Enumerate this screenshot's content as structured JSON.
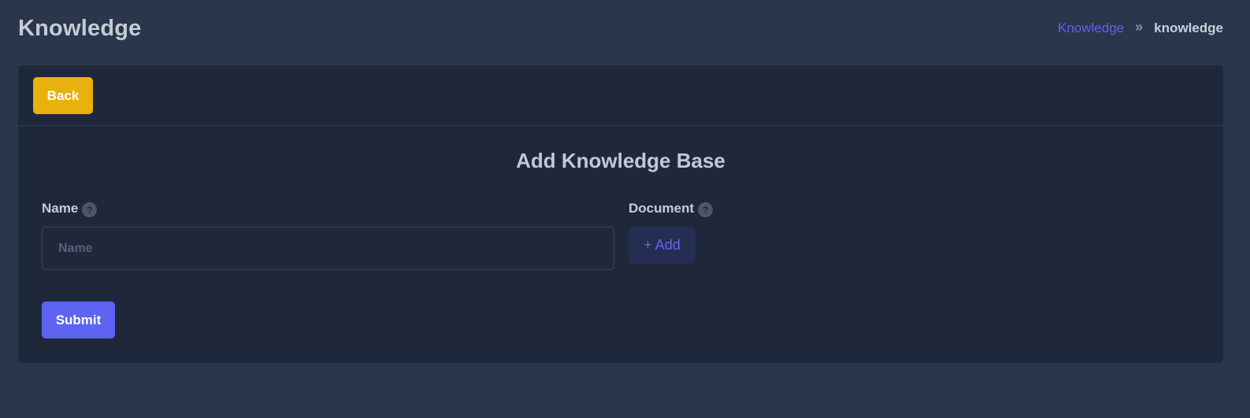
{
  "header": {
    "title": "Knowledge",
    "breadcrumb": {
      "link_label": "Knowledge",
      "separator": "»",
      "current_label": "knowledge"
    }
  },
  "card": {
    "back_label": "Back",
    "form_title": "Add Knowledge Base",
    "name_field": {
      "label": "Name",
      "help_icon": "question-circle-icon",
      "help_glyph": "?",
      "placeholder": "Name",
      "value": ""
    },
    "document_field": {
      "label": "Document",
      "help_icon": "question-circle-icon",
      "help_glyph": "?",
      "add_label": "+ Add"
    },
    "submit_label": "Submit"
  },
  "colors": {
    "page_background": "#2a364c",
    "card_background": "#1f283b",
    "accent": "#5c64f1",
    "back_button": "#e8b10d",
    "link": "#5b63f0"
  }
}
